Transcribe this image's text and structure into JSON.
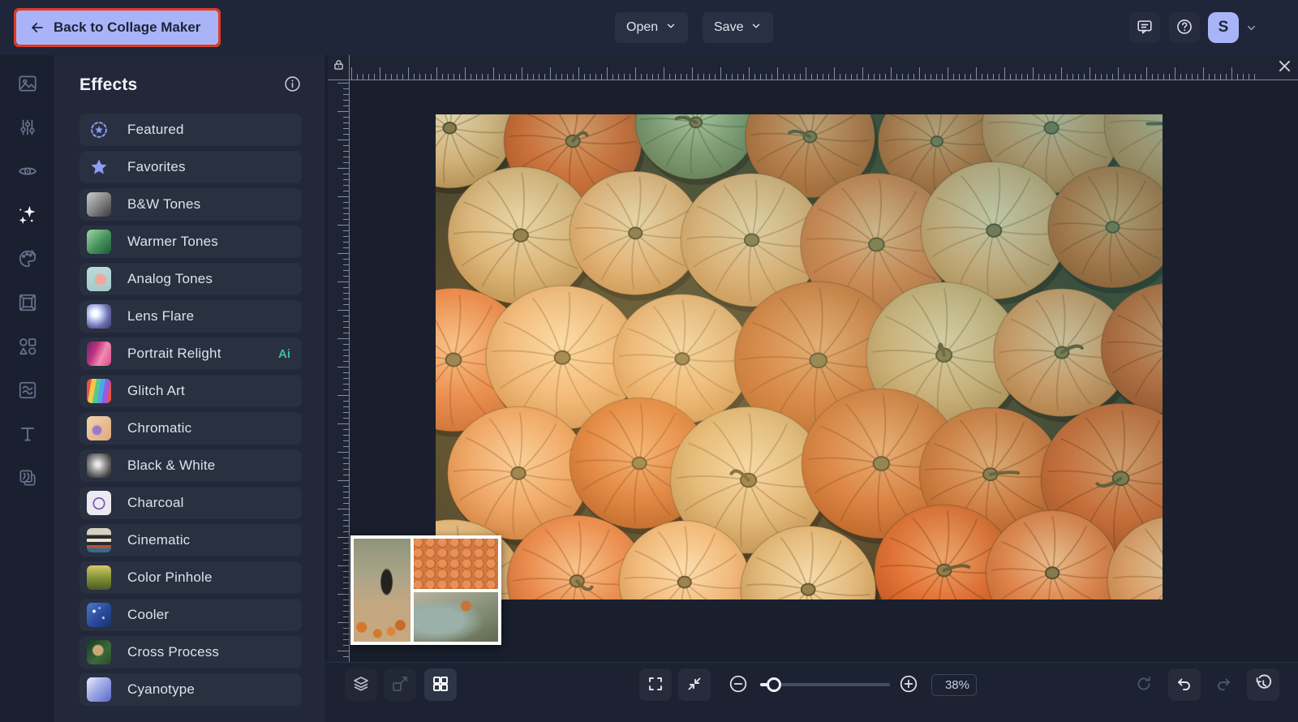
{
  "header": {
    "back_button_label": "Back to Collage Maker",
    "open_button_label": "Open",
    "save_button_label": "Save",
    "avatar_initial": "S"
  },
  "toolbar_rail_icons": [
    "image-manager",
    "edit",
    "touch-up",
    "effects",
    "artsy",
    "frames",
    "graphics",
    "textures",
    "text",
    "layers"
  ],
  "effects_panel": {
    "title": "Effects",
    "items": [
      {
        "label": "Featured"
      },
      {
        "label": "Favorites"
      },
      {
        "label": "B&W Tones"
      },
      {
        "label": "Warmer Tones"
      },
      {
        "label": "Analog Tones"
      },
      {
        "label": "Lens Flare"
      },
      {
        "label": "Portrait Relight",
        "badge": "Ai"
      },
      {
        "label": "Glitch Art"
      },
      {
        "label": "Chromatic"
      },
      {
        "label": "Black & White"
      },
      {
        "label": "Charcoal"
      },
      {
        "label": "Cinematic"
      },
      {
        "label": "Color Pinhole"
      },
      {
        "label": "Cooler"
      },
      {
        "label": "Cross Process"
      },
      {
        "label": "Cyanotype"
      }
    ]
  },
  "canvas": {
    "zoom_value": "38%"
  },
  "colors": {
    "accent_lavender": "#a9b4f8",
    "annotation_red": "#e23b22",
    "ai_badge_teal": "#35bfa0",
    "topbar_bg": "#202639",
    "panel_bg": "#222839",
    "canvas_bg": "#1a1f2d"
  }
}
